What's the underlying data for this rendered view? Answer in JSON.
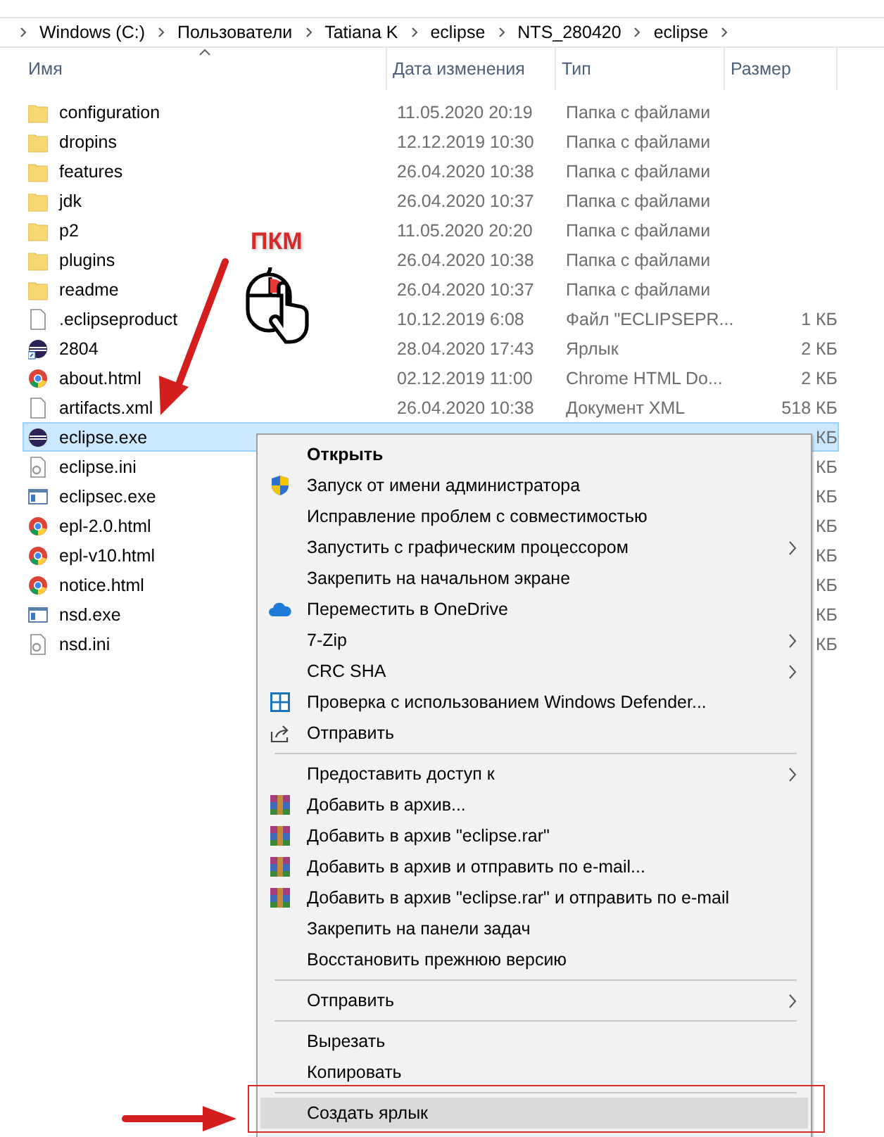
{
  "breadcrumb": [
    "Windows (C:)",
    "Пользователи",
    "Tatiana K",
    "eclipse",
    "NTS_280420",
    "eclipse"
  ],
  "columns": [
    {
      "label": "Имя",
      "sorted": true
    },
    {
      "label": "Дата изменения",
      "sorted": false
    },
    {
      "label": "Тип",
      "sorted": false
    },
    {
      "label": "Размер",
      "sorted": false
    }
  ],
  "files": [
    {
      "kind": "folder",
      "name": "configuration",
      "date": "11.05.2020 20:19",
      "type": "Папка с файлами",
      "selected": false
    },
    {
      "kind": "folder",
      "name": "dropins",
      "date": "12.12.2019 10:30",
      "type": "Папка с файлами",
      "selected": false
    },
    {
      "kind": "folder",
      "name": "features",
      "date": "26.04.2020 10:38",
      "type": "Папка с файлами",
      "selected": false
    },
    {
      "kind": "folder",
      "name": "jdk",
      "date": "26.04.2020 10:37",
      "type": "Папка с файлами",
      "selected": false
    },
    {
      "kind": "folder",
      "name": "p2",
      "date": "11.05.2020 20:20",
      "type": "Папка с файлами",
      "selected": false
    },
    {
      "kind": "folder",
      "name": "plugins",
      "date": "26.04.2020 10:38",
      "type": "Папка с файлами",
      "selected": false
    },
    {
      "kind": "folder",
      "name": "readme",
      "date": "26.04.2020 10:37",
      "type": "Папка с файлами",
      "selected": false
    },
    {
      "kind": "document",
      "name": ".eclipseproduct",
      "date": "10.12.2019 6:08",
      "type": "Файл \"ECLIPSEPR...",
      "size": "1 КБ",
      "selected": false
    },
    {
      "kind": "shortcut",
      "name": "2804",
      "date": "28.04.2020 17:43",
      "type": "Ярлык",
      "size": "2 КБ",
      "selected": false
    },
    {
      "kind": "webpage",
      "name": "about.html",
      "date": "02.12.2019 11:00",
      "type": "Chrome HTML Do...",
      "size": "2 КБ",
      "selected": false
    },
    {
      "kind": "document",
      "name": "artifacts.xml",
      "date": "26.04.2020 10:38",
      "type": "Документ XML",
      "size": "518 КБ",
      "selected": false
    },
    {
      "kind": "eclipse",
      "name": "eclipse.exe",
      "size": "КБ",
      "selected": true
    },
    {
      "kind": "settings",
      "name": "eclipse.ini",
      "size": "КБ",
      "selected": false
    },
    {
      "kind": "program",
      "name": "eclipsec.exe",
      "size": "КБ",
      "selected": false
    },
    {
      "kind": "webpage",
      "name": "epl-2.0.html",
      "size": "КБ",
      "selected": false
    },
    {
      "kind": "webpage",
      "name": "epl-v10.html",
      "size": "КБ",
      "selected": false
    },
    {
      "kind": "webpage",
      "name": "notice.html",
      "size": "КБ",
      "selected": false
    },
    {
      "kind": "program",
      "name": "nsd.exe",
      "size": "КБ",
      "selected": false
    },
    {
      "kind": "settings",
      "name": "nsd.ini",
      "size": "КБ",
      "selected": false
    }
  ],
  "context_menu": [
    {
      "kind": "plain",
      "label": "Открыть",
      "bold": true,
      "submenu": false,
      "highlighted": false
    },
    {
      "kind": "admin",
      "label": "Запуск от имени администратора",
      "bold": false,
      "submenu": false,
      "highlighted": false
    },
    {
      "kind": "plain",
      "label": "Исправление проблем с совместимостью",
      "bold": false,
      "submenu": false,
      "highlighted": false
    },
    {
      "kind": "plain",
      "label": "Запустить с графическим процессором",
      "bold": false,
      "submenu": true,
      "highlighted": false
    },
    {
      "kind": "plain",
      "label": "Закрепить на начальном экране",
      "bold": false,
      "submenu": false,
      "highlighted": false
    },
    {
      "kind": "cloud",
      "label": "Переместить в OneDrive",
      "bold": false,
      "submenu": false,
      "highlighted": false
    },
    {
      "kind": "plain",
      "label": "7-Zip",
      "bold": false,
      "submenu": true,
      "highlighted": false
    },
    {
      "kind": "plain",
      "label": "CRC SHA",
      "bold": false,
      "submenu": true,
      "highlighted": false
    },
    {
      "kind": "scan",
      "label": "Проверка с использованием Windows Defender...",
      "bold": false,
      "submenu": false,
      "highlighted": false
    },
    {
      "kind": "share",
      "label": "Отправить",
      "bold": false,
      "submenu": false,
      "highlighted": false
    },
    {
      "kind": "separator"
    },
    {
      "kind": "plain",
      "label": "Предоставить доступ к",
      "bold": false,
      "submenu": true,
      "highlighted": false
    },
    {
      "kind": "archive",
      "label": "Добавить в архив...",
      "bold": false,
      "submenu": false,
      "highlighted": false
    },
    {
      "kind": "archive",
      "label": "Добавить в архив \"eclipse.rar\"",
      "bold": false,
      "submenu": false,
      "highlighted": false
    },
    {
      "kind": "archive",
      "label": "Добавить в архив и отправить по e-mail...",
      "bold": false,
      "submenu": false,
      "highlighted": false
    },
    {
      "kind": "archive",
      "label": "Добавить в архив \"eclipse.rar\" и отправить по e-mail",
      "bold": false,
      "submenu": false,
      "highlighted": false
    },
    {
      "kind": "plain",
      "label": "Закрепить на панели задач",
      "bold": false,
      "submenu": false,
      "highlighted": false
    },
    {
      "kind": "plain",
      "label": "Восстановить прежнюю версию",
      "bold": false,
      "submenu": false,
      "highlighted": false
    },
    {
      "kind": "separator"
    },
    {
      "kind": "plain",
      "label": "Отправить",
      "bold": false,
      "submenu": true,
      "highlighted": false
    },
    {
      "kind": "separator"
    },
    {
      "kind": "plain",
      "label": "Вырезать",
      "bold": false,
      "submenu": false,
      "highlighted": false
    },
    {
      "kind": "plain",
      "label": "Копировать",
      "bold": false,
      "submenu": false,
      "highlighted": false
    },
    {
      "kind": "separator"
    },
    {
      "kind": "plain",
      "label": "Создать ярлык",
      "bold": false,
      "submenu": false,
      "highlighted": true
    }
  ],
  "annotation": {
    "label": "ПКМ"
  }
}
